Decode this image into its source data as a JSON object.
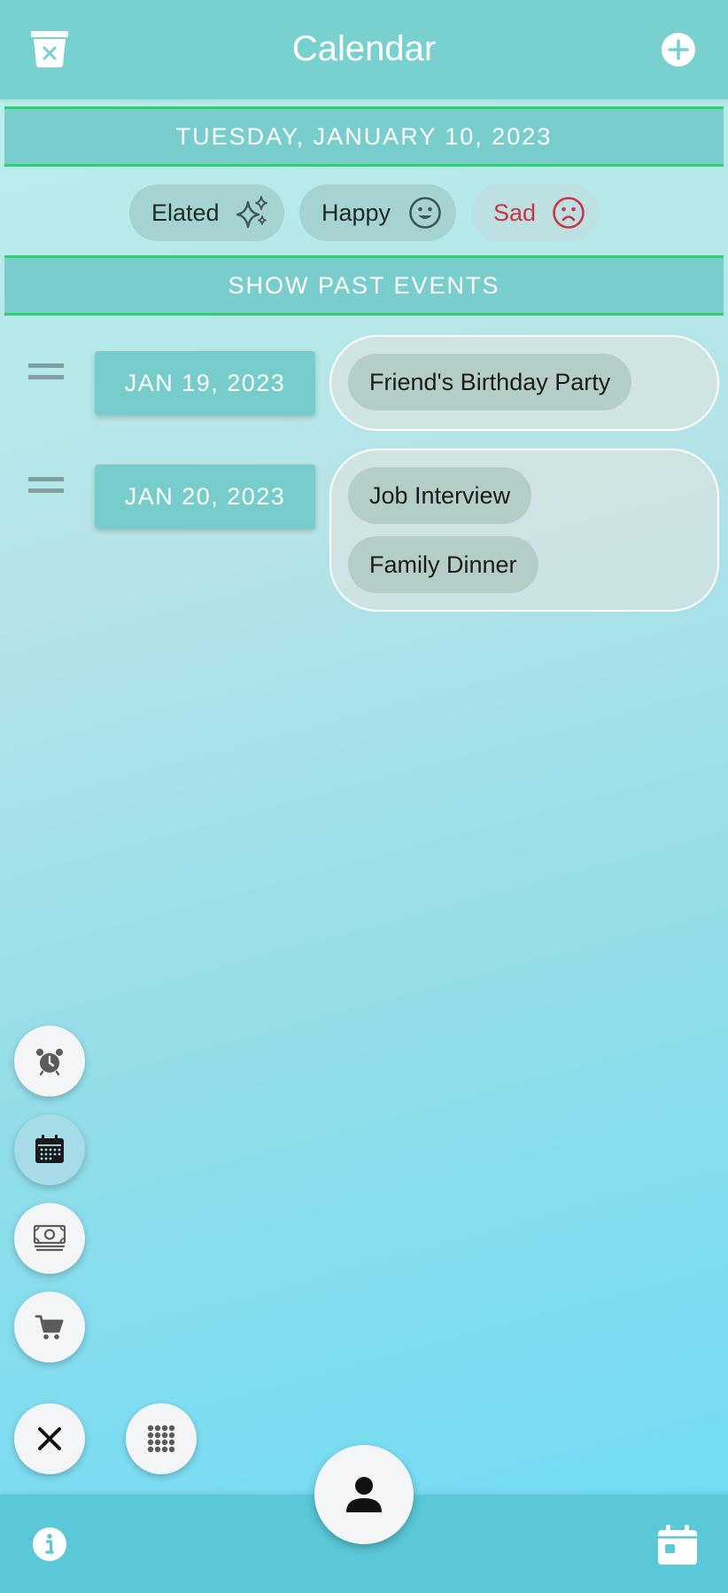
{
  "header": {
    "title": "Calendar",
    "left_icon": "trash-icon",
    "right_icon": "plus-circle-icon"
  },
  "selected_date": "TUESDAY, JANUARY 10, 2023",
  "moods": [
    {
      "label": "Elated",
      "icon": "sparkles-icon"
    },
    {
      "label": "Happy",
      "icon": "smile-icon"
    },
    {
      "label": "Sad",
      "icon": "frown-icon",
      "color": "#c93447"
    }
  ],
  "past_events_label": "SHOW PAST EVENTS",
  "event_groups": [
    {
      "date": "JAN 19, 2023",
      "events": [
        "Friend's Birthday Party"
      ]
    },
    {
      "date": "JAN 20, 2023",
      "events": [
        "Job Interview",
        "Family Dinner"
      ]
    }
  ],
  "fab_menu": [
    {
      "icon": "alarm-clock-icon"
    },
    {
      "icon": "calendar-grid-icon",
      "active": true
    },
    {
      "icon": "money-icon"
    },
    {
      "icon": "shopping-cart-icon"
    }
  ],
  "bottom_actions": {
    "close_icon": "close-icon",
    "grid_icon": "apps-grid-icon",
    "profile_icon": "user-icon",
    "info_icon": "info-icon",
    "calendar_icon": "calendar-icon"
  },
  "colors": {
    "header": "#79d1cf",
    "bar_border": "#2fd06b",
    "date_pill": "#76cdcc",
    "bottom_bar": "#5ac8d7",
    "sad_text": "#c93447"
  }
}
